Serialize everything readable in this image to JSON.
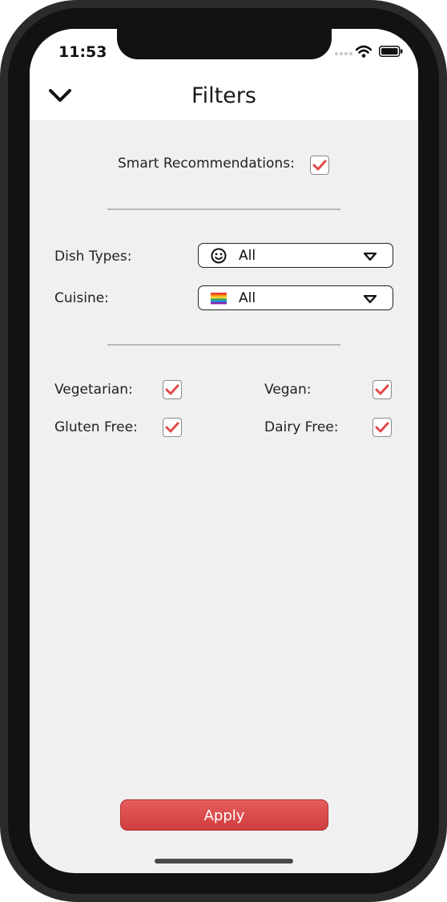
{
  "status_bar": {
    "time": "11:53"
  },
  "header": {
    "title": "Filters"
  },
  "smart": {
    "label": "Smart Recommendations:",
    "checked": true
  },
  "dish_types": {
    "label": "Dish Types:",
    "value": "All",
    "icon": "smiley-icon"
  },
  "cuisine": {
    "label": "Cuisine:",
    "value": "All",
    "icon": "rainbow-flag-icon"
  },
  "diets": [
    {
      "label": "Vegetarian:",
      "checked": true
    },
    {
      "label": "Vegan:",
      "checked": true
    },
    {
      "label": "Gluten Free:",
      "checked": true
    },
    {
      "label": "Dairy Free:",
      "checked": true
    }
  ],
  "apply": {
    "label": "Apply"
  },
  "colors": {
    "accent": "#e04a4a",
    "background": "#f0f0f0"
  }
}
